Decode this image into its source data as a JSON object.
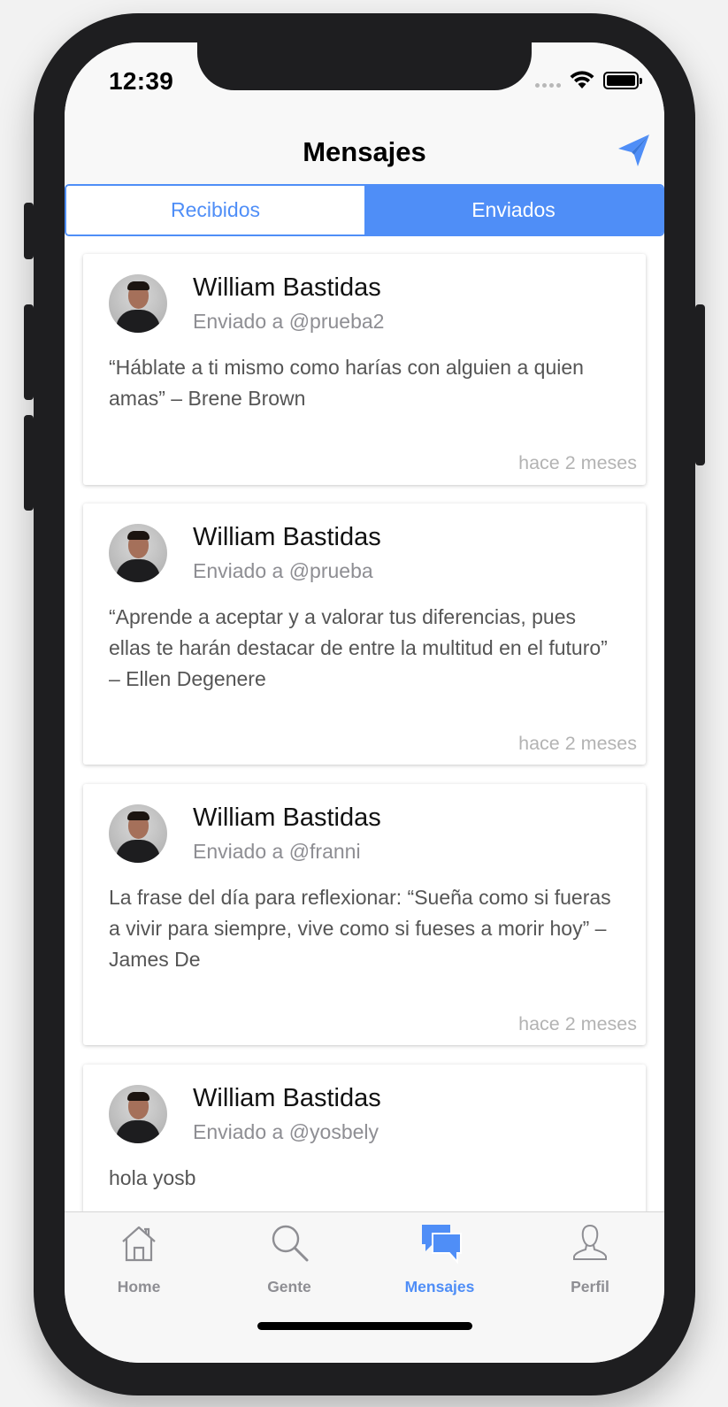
{
  "status_bar": {
    "time": "12:39"
  },
  "header": {
    "title": "Mensajes",
    "send_icon": "paper-plane-icon"
  },
  "segmented_control": {
    "selected": "Enviados",
    "segments": [
      {
        "label": "Recibidos"
      },
      {
        "label": "Enviados"
      }
    ]
  },
  "messages": [
    {
      "author": "William Bastidas",
      "recipient": "Enviado a @prueba2",
      "text": "“Háblate a ti mismo como harías con alguien a quien amas” – Brene Brown",
      "time": "hace 2 meses"
    },
    {
      "author": "William Bastidas",
      "recipient": "Enviado a @prueba",
      "text": "“Aprende a aceptar y a valorar tus diferencias, pues ellas te harán destacar de entre la multitud en el futuro” – Ellen Degenere",
      "time": "hace 2 meses"
    },
    {
      "author": "William Bastidas",
      "recipient": "Enviado a @franni",
      "text": "La frase del día para reflexionar: “Sueña como si fueras a vivir para siempre, vive como si fueses a morir hoy” – James De",
      "time": "hace 2 meses"
    },
    {
      "author": "William Bastidas",
      "recipient": "Enviado a @yosbely",
      "text": "hola yosb",
      "time": ""
    }
  ],
  "tab_bar": {
    "selected": "Mensajes",
    "items": [
      {
        "label": "Home",
        "icon": "house-icon"
      },
      {
        "label": "Gente",
        "icon": "magnifier-icon"
      },
      {
        "label": "Mensajes",
        "icon": "chat-bubbles-icon"
      },
      {
        "label": "Perfil",
        "icon": "person-icon"
      }
    ]
  },
  "colors": {
    "accent": "#4f8ef7",
    "secondary_text": "#8e8e93",
    "timestamp": "#b3b3b3"
  }
}
